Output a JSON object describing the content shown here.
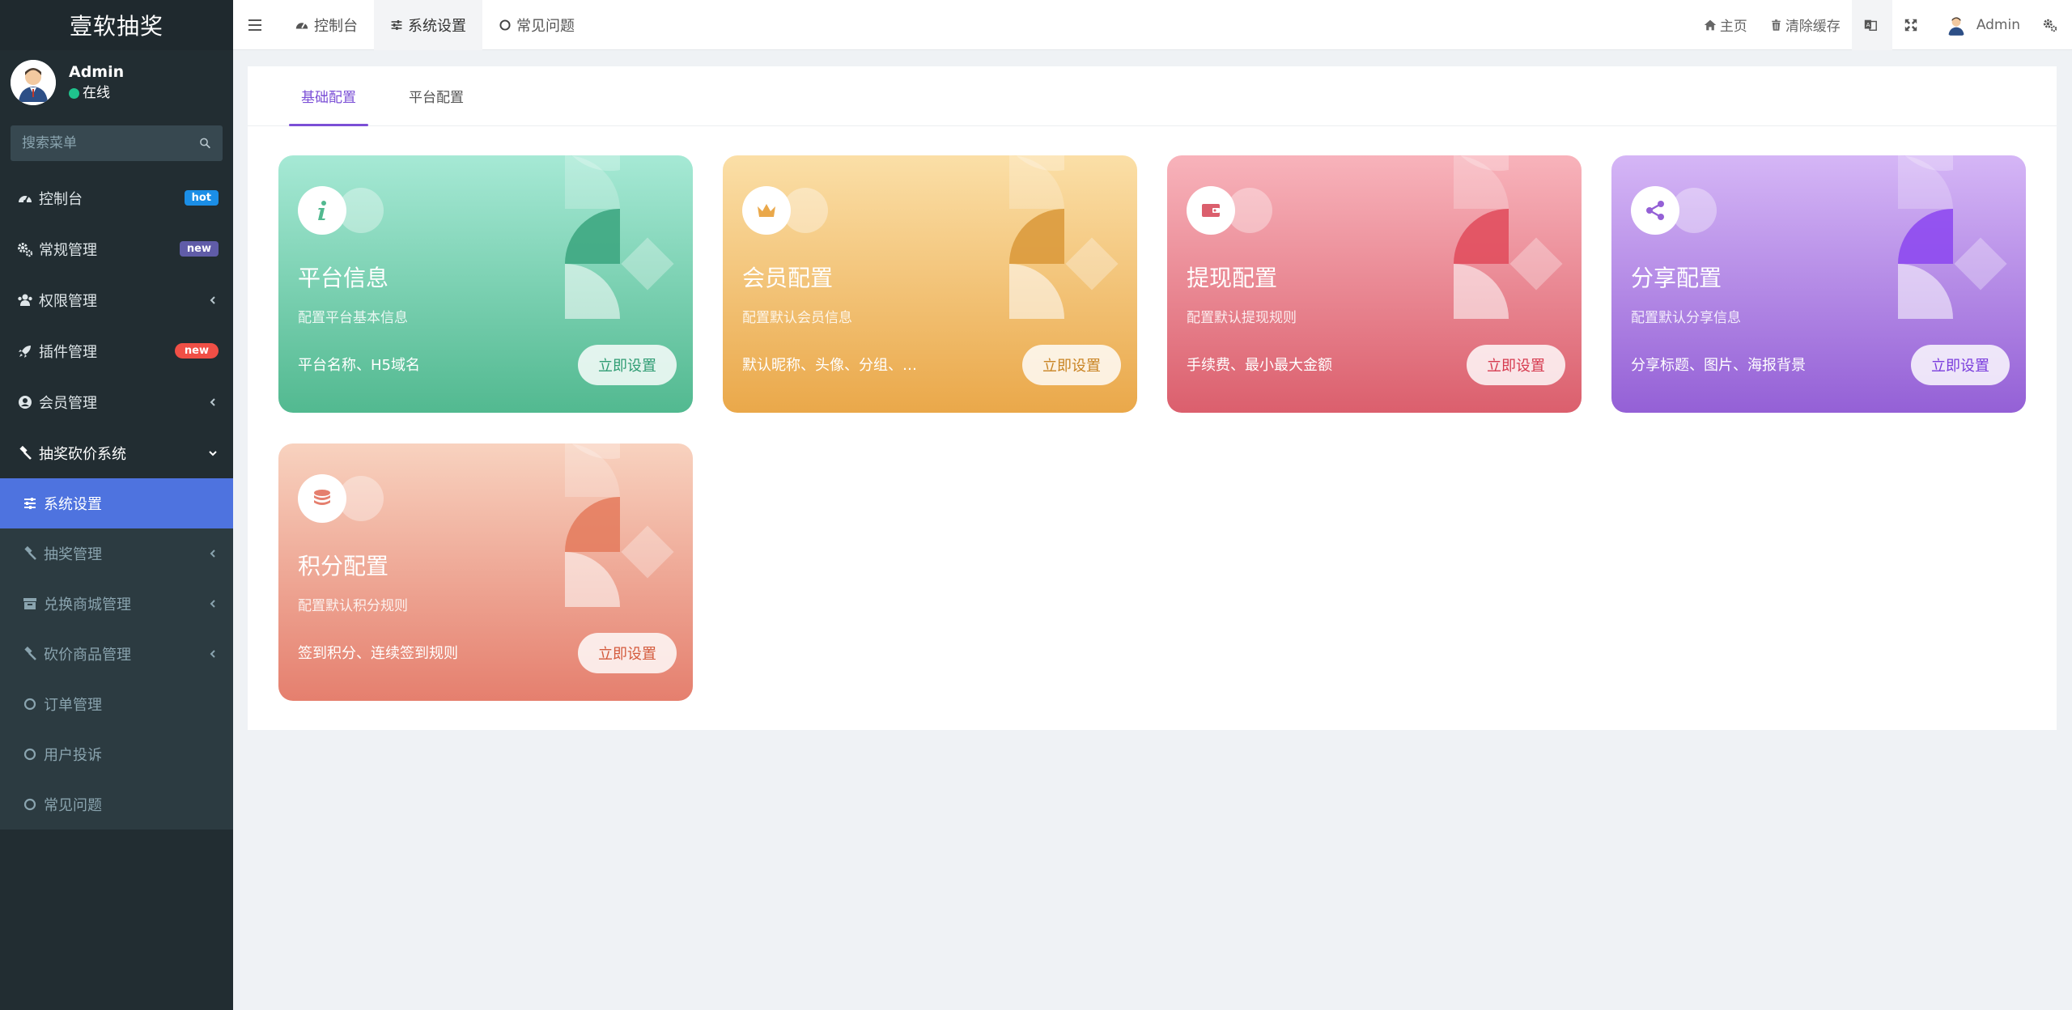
{
  "app": {
    "logo_text": "壹软抽奖"
  },
  "user": {
    "name": "Admin",
    "status": "在线"
  },
  "sidebar": {
    "search_placeholder": "搜索菜单",
    "items": [
      {
        "label": "控制台",
        "icon": "dashboard-icon",
        "badge": "hot"
      },
      {
        "label": "常规管理",
        "icon": "cogs-icon",
        "badge": "new"
      },
      {
        "label": "权限管理",
        "icon": "users-icon",
        "chevron": "left"
      },
      {
        "label": "插件管理",
        "icon": "rocket-icon",
        "badge": "new"
      },
      {
        "label": "会员管理",
        "icon": "user-circle-icon",
        "chevron": "left"
      },
      {
        "label": "抽奖砍价系统",
        "icon": "gavel-icon",
        "chevron": "down"
      }
    ],
    "subitems": [
      {
        "label": "系统设置",
        "icon": "sliders-icon",
        "active": true
      },
      {
        "label": "抽奖管理",
        "icon": "gavel-icon",
        "chevron": "left"
      },
      {
        "label": "兑换商城管理",
        "icon": "archive-icon",
        "chevron": "left"
      },
      {
        "label": "砍价商品管理",
        "icon": "gavel-icon",
        "chevron": "left"
      },
      {
        "label": "订单管理",
        "icon": "circle-icon"
      },
      {
        "label": "用户投诉",
        "icon": "circle-icon"
      },
      {
        "label": "常见问题",
        "icon": "circle-icon"
      }
    ]
  },
  "topbar": {
    "tabs": [
      {
        "label": "控制台",
        "icon": "dashboard-icon"
      },
      {
        "label": "系统设置",
        "icon": "sliders-icon",
        "active": true
      },
      {
        "label": "常见问题",
        "icon": "circle-icon"
      }
    ],
    "home_label": "主页",
    "clear_cache_label": "清除缓存",
    "admin_label": "Admin"
  },
  "panel": {
    "tabs": [
      {
        "label": "基础配置",
        "active": true
      },
      {
        "label": "平台配置"
      }
    ]
  },
  "cards": [
    {
      "title": "平台信息",
      "subtitle": "配置平台基本信息",
      "desc": "平台名称、H5域名",
      "button": "立即设置",
      "icon": "info-icon",
      "gradient_from": "#a6e9d5",
      "gradient_to": "#52b990",
      "accent": "#3aa57e",
      "btn_text": "#2f9c73"
    },
    {
      "title": "会员配置",
      "subtitle": "配置默认会员信息",
      "desc": "默认昵称、头像、分组、…",
      "button": "立即设置",
      "icon": "crown-icon",
      "gradient_from": "#fbdfa7",
      "gradient_to": "#eaa84a",
      "accent": "#d99838",
      "btn_text": "#c98423"
    },
    {
      "title": "提现配置",
      "subtitle": "配置默认提现规则",
      "desc": "手续费、最小最大金额",
      "button": "立即设置",
      "icon": "wallet-icon",
      "gradient_from": "#f8b3bb",
      "gradient_to": "#db5f6d",
      "accent": "#e04a5a",
      "btn_text": "#d63a4f"
    },
    {
      "title": "分享配置",
      "subtitle": "配置默认分享信息",
      "desc": "分享标题、图片、海报背景",
      "button": "立即设置",
      "icon": "share-icon",
      "gradient_from": "#d5b6f6",
      "gradient_to": "#9460d6",
      "accent": "#8b45f0",
      "btn_text": "#7a3ddd"
    },
    {
      "title": "积分配置",
      "subtitle": "配置默认积分规则",
      "desc": "签到积分、连续签到规则",
      "button": "立即设置",
      "icon": "coins-icon",
      "gradient_from": "#f8d2bf",
      "gradient_to": "#e57f6e",
      "accent": "#e47a5c",
      "btn_text": "#d45b3d"
    }
  ]
}
